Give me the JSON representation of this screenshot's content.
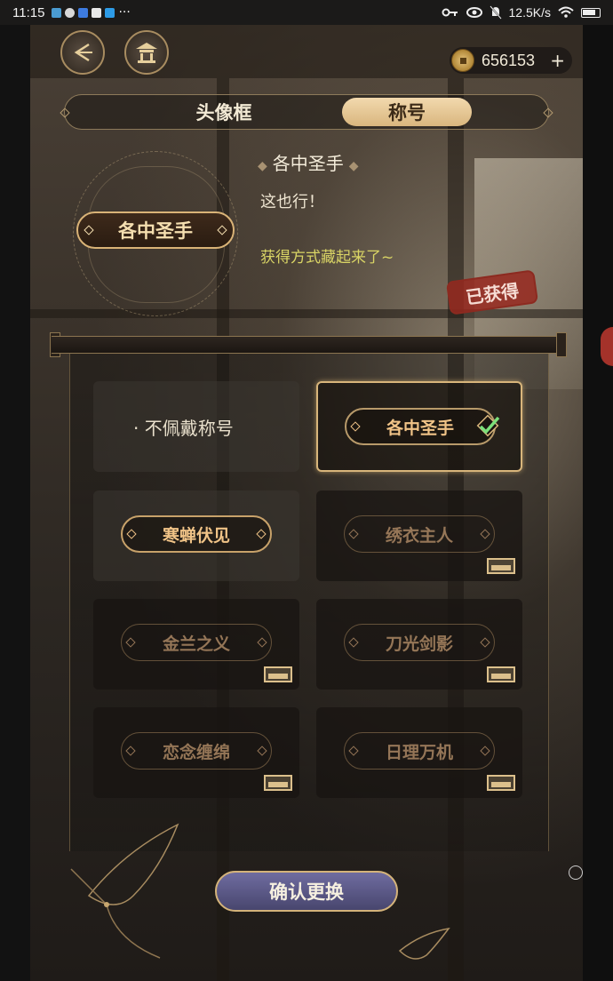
{
  "status_bar": {
    "time": "11:15",
    "ellipsis": "···",
    "network_speed": "12.5K/s",
    "battery_level_percent": 100
  },
  "header": {
    "back_icon": "back-arrow-icon",
    "home_icon": "pavilion-icon",
    "currency_amount": "656153",
    "add_label": "+"
  },
  "tabs": [
    {
      "label": "头像框",
      "active": false
    },
    {
      "label": "称号",
      "active": true
    }
  ],
  "preview": {
    "chip_label": "各中圣手",
    "name": "各中圣手",
    "description": "这也行！",
    "hint": "获得方式藏起来了~",
    "status_stamp": "已获得"
  },
  "titles": {
    "none_label": "不佩戴称号",
    "items": [
      {
        "label": "各中圣手",
        "state": "selected",
        "equipped": true
      },
      {
        "label": "寒蝉伏见",
        "state": "owned"
      },
      {
        "label": "绣衣主人",
        "state": "locked"
      },
      {
        "label": "金兰之义",
        "state": "locked"
      },
      {
        "label": "刀光剑影",
        "state": "locked"
      },
      {
        "label": "恋念缠绵",
        "state": "locked"
      },
      {
        "label": "日理万机",
        "state": "locked"
      }
    ]
  },
  "actions": {
    "confirm_label": "确认更换"
  },
  "colors": {
    "accent_gold": "#d8b57b",
    "active_tab": "#e9c894",
    "stamp_red": "#963228",
    "hint_yellow": "#d9d465",
    "confirm_purple": "#5d5a8a"
  }
}
